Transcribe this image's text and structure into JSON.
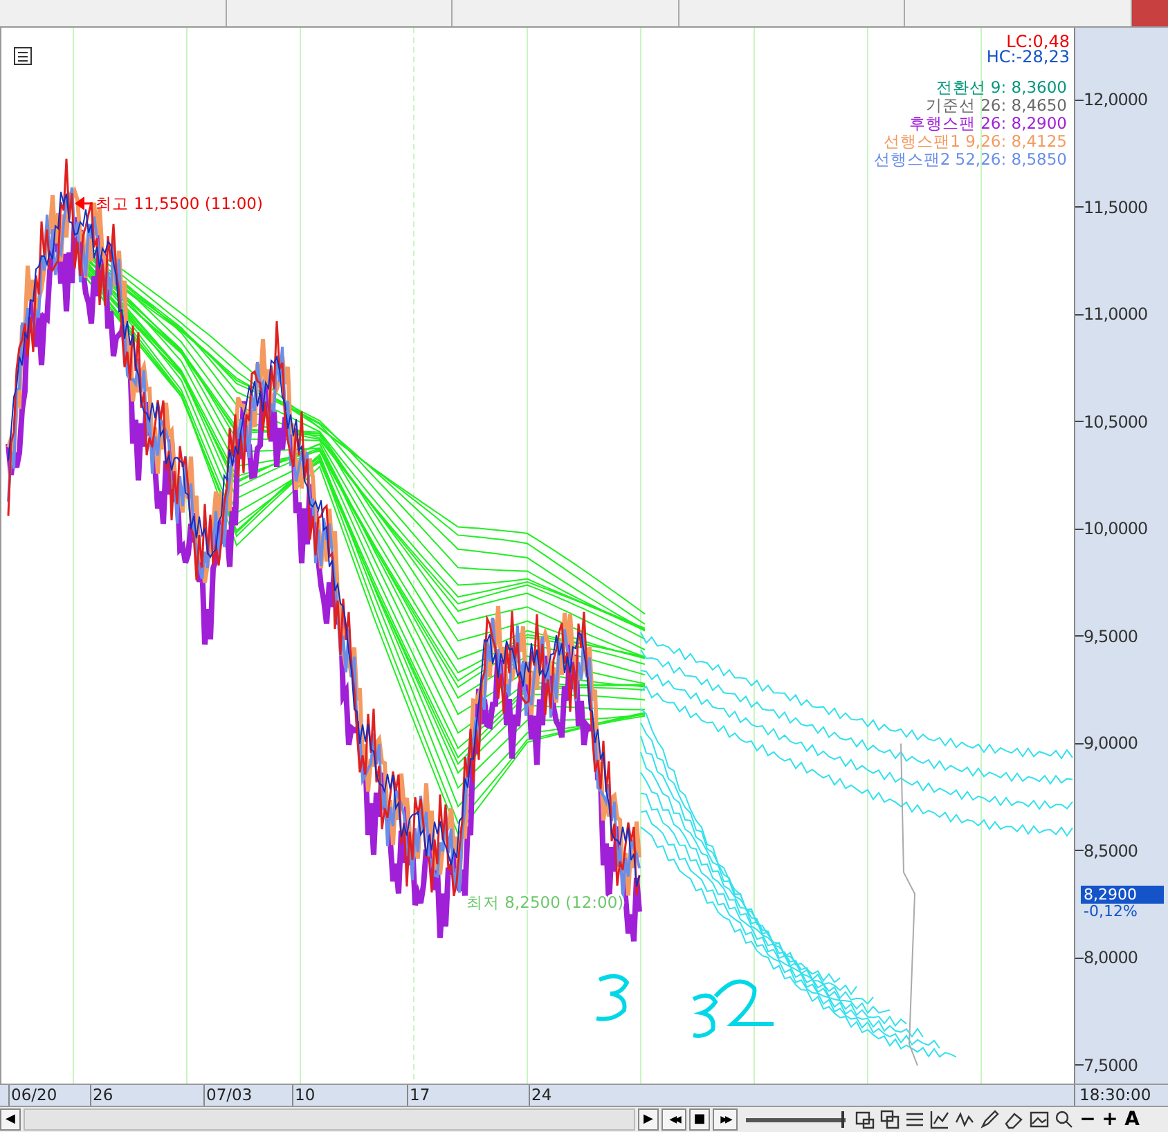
{
  "indicators": {
    "lc": "LC:0,48",
    "hc": "HC:-28,23"
  },
  "legend": [
    {
      "label": "전환선 9: 8,3600",
      "color": "#00977a"
    },
    {
      "label": "기준선 26: 8,4650",
      "color": "#6a6a6a"
    },
    {
      "label": "후행스팬 26: 8,2900",
      "color": "#a020d8"
    },
    {
      "label": "선행스팬1 9,26: 8,4125",
      "color": "#f49a60"
    },
    {
      "label": "선행스팬2 52,26: 8,5850",
      "color": "#6a8ee8"
    }
  ],
  "y_axis": {
    "labels": [
      "12,0000",
      "11,5000",
      "11,0000",
      "10,5000",
      "10,0000",
      "9,5000",
      "9,0000",
      "8,5000",
      "8,0000",
      "7,5000"
    ]
  },
  "price_tag": {
    "value": "8,2900",
    "change": "-0,12%"
  },
  "annotations": {
    "high": "최고 11,5500 (11:00)",
    "low": "최저 8,2500 (12:00)"
  },
  "x_axis": {
    "labels": [
      "06/20",
      "26",
      "07/03",
      "10",
      "17",
      "24"
    ],
    "time": "18:30:00"
  },
  "toolbar": {
    "zoom_slider": {
      "level": 0.97
    },
    "scroll_left": "◀",
    "play": "▶",
    "rewind": "◀◀",
    "stop": "■",
    "forward": "▶▶",
    "minus": "−",
    "plus": "+",
    "text_tool": "A"
  }
}
